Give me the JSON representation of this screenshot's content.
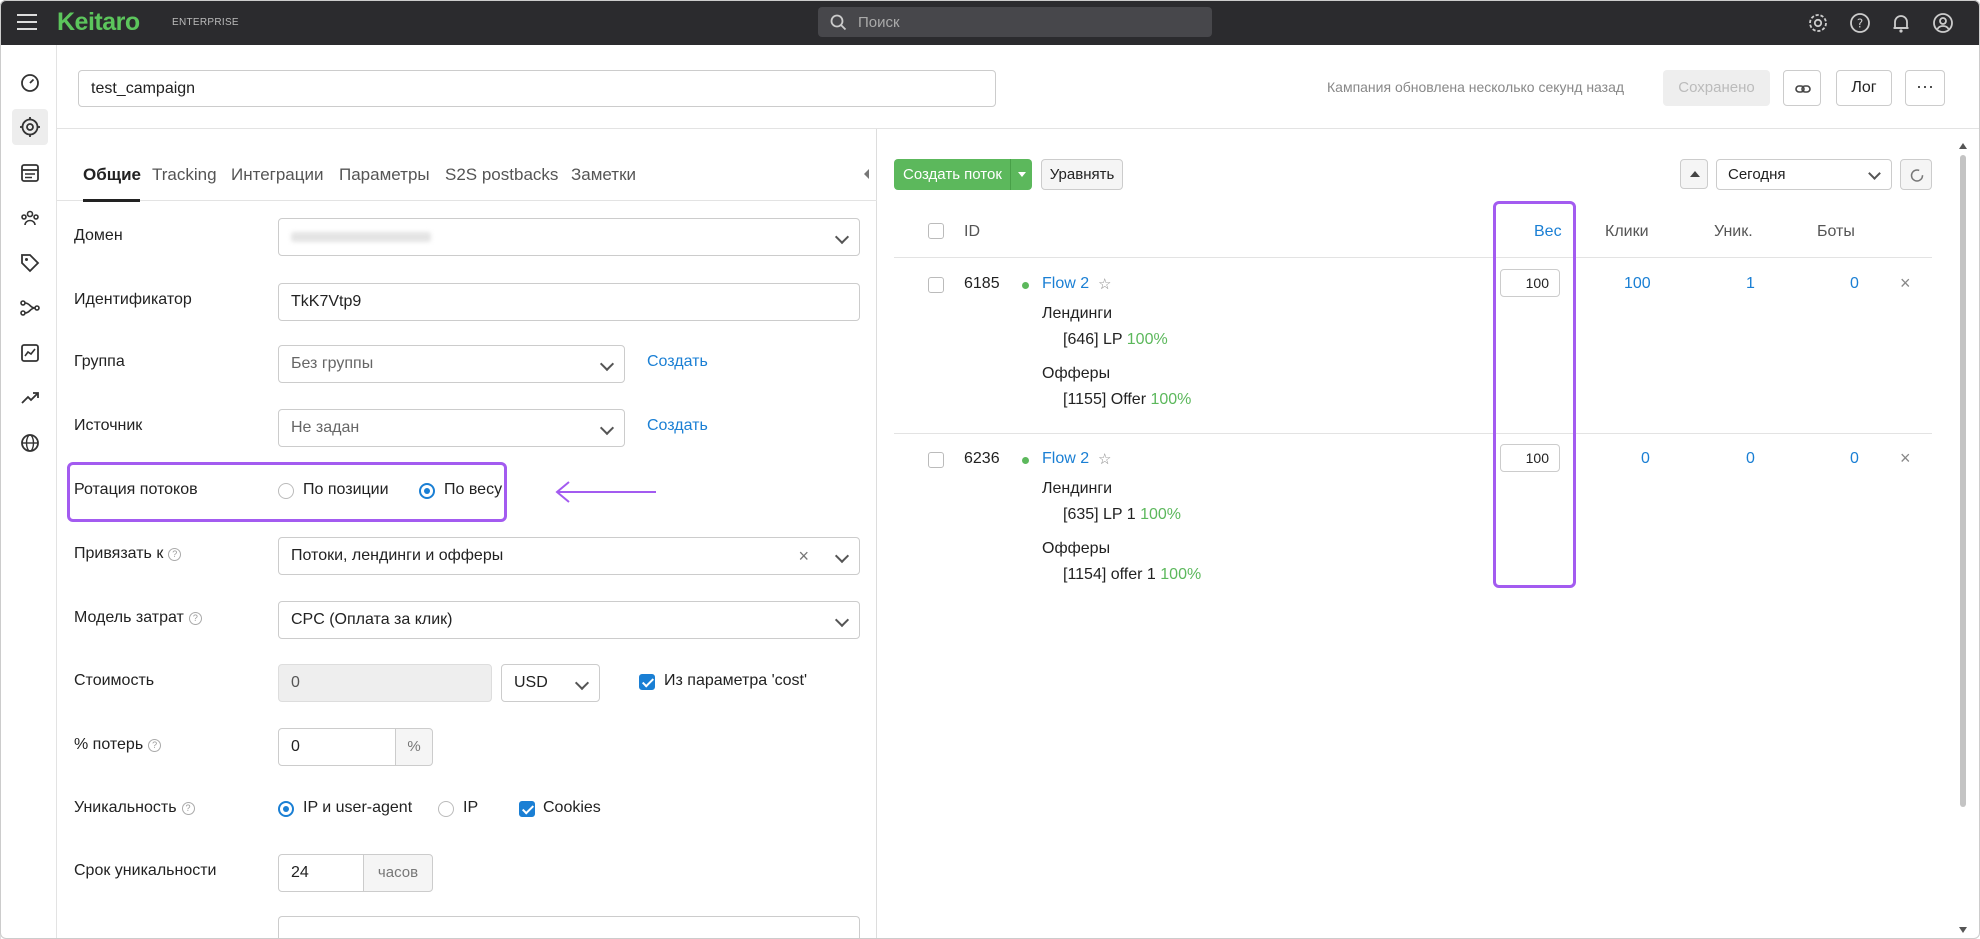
{
  "app": {
    "logo": "Keitaro",
    "edition": "ENTERPRISE"
  },
  "search": {
    "placeholder": "Поиск"
  },
  "header_icons": [
    "gear-icon",
    "help-icon",
    "bell-icon",
    "user-icon"
  ],
  "sidebar": {
    "icons": [
      "dashboard-icon",
      "campaigns-icon",
      "reports-icon",
      "users-icon",
      "tags-icon",
      "flows-icon",
      "analytics-icon",
      "trends-icon",
      "globe-icon"
    ]
  },
  "campaign": {
    "name": "test_campaign",
    "updated": "Кампания обновлена несколько секунд назад",
    "saved_label": "Сохранено",
    "log_label": "Лог",
    "more_label": "···"
  },
  "tabs": [
    "Общие",
    "Tracking",
    "Интеграции",
    "Параметры",
    "S2S postbacks",
    "Заметки"
  ],
  "form": {
    "domain": {
      "label": "Домен",
      "value": ""
    },
    "identifier": {
      "label": "Идентификатор",
      "value": "TkK7Vtp9"
    },
    "group": {
      "label": "Группа",
      "value": "Без группы",
      "create": "Создать"
    },
    "source": {
      "label": "Источник",
      "value": "Не задан",
      "create": "Создать"
    },
    "rotation": {
      "label": "Ротация потоков",
      "option1": "По позиции",
      "option2": "По весу",
      "selected": "По весу"
    },
    "bind": {
      "label": "Привязать к",
      "value": "Потоки, лендинги и офферы"
    },
    "cost_model": {
      "label": "Модель затрат",
      "value": "CPC (Оплата за клик)"
    },
    "cost": {
      "label": "Стоимость",
      "value": "0",
      "currency": "USD",
      "from_param": "Из параметра 'cost'"
    },
    "loss": {
      "label": "% потерь",
      "value": "0",
      "suffix": "%"
    },
    "uniqueness": {
      "label": "Уникальность",
      "option1": "IP и user-agent",
      "option2": "IP",
      "cookies": "Cookies"
    },
    "uniq_term": {
      "label": "Срок уникальности",
      "value": "24",
      "suffix": "часов"
    }
  },
  "flows_panel": {
    "create_label": "Создать поток",
    "align_label": "Уравнять",
    "date_range": "Сегодня",
    "columns": {
      "id": "ID",
      "weight": "Вес",
      "clicks": "Клики",
      "unique": "Уник.",
      "bots": "Боты"
    },
    "flows": [
      {
        "id": "6185",
        "name": "Flow 2",
        "landings_title": "Лендинги",
        "landing": "[646] LP",
        "landing_pct": "100%",
        "offers_title": "Офферы",
        "offer": "[1155] Offer",
        "offer_pct": "100%",
        "weight": "100",
        "clicks": "100",
        "unique": "1",
        "bots": "0"
      },
      {
        "id": "6236",
        "name": "Flow 2",
        "landings_title": "Лендинги",
        "landing": "[635] LP 1",
        "landing_pct": "100%",
        "offers_title": "Офферы",
        "offer": "[1154] offer 1",
        "offer_pct": "100%",
        "weight": "100",
        "clicks": "0",
        "unique": "0",
        "bots": "0"
      }
    ]
  },
  "colors": {
    "brand": "#5cc55c",
    "accent": "#1a7fd4",
    "highlight": "#a35bf0",
    "topbar": "#2b2b2e"
  }
}
